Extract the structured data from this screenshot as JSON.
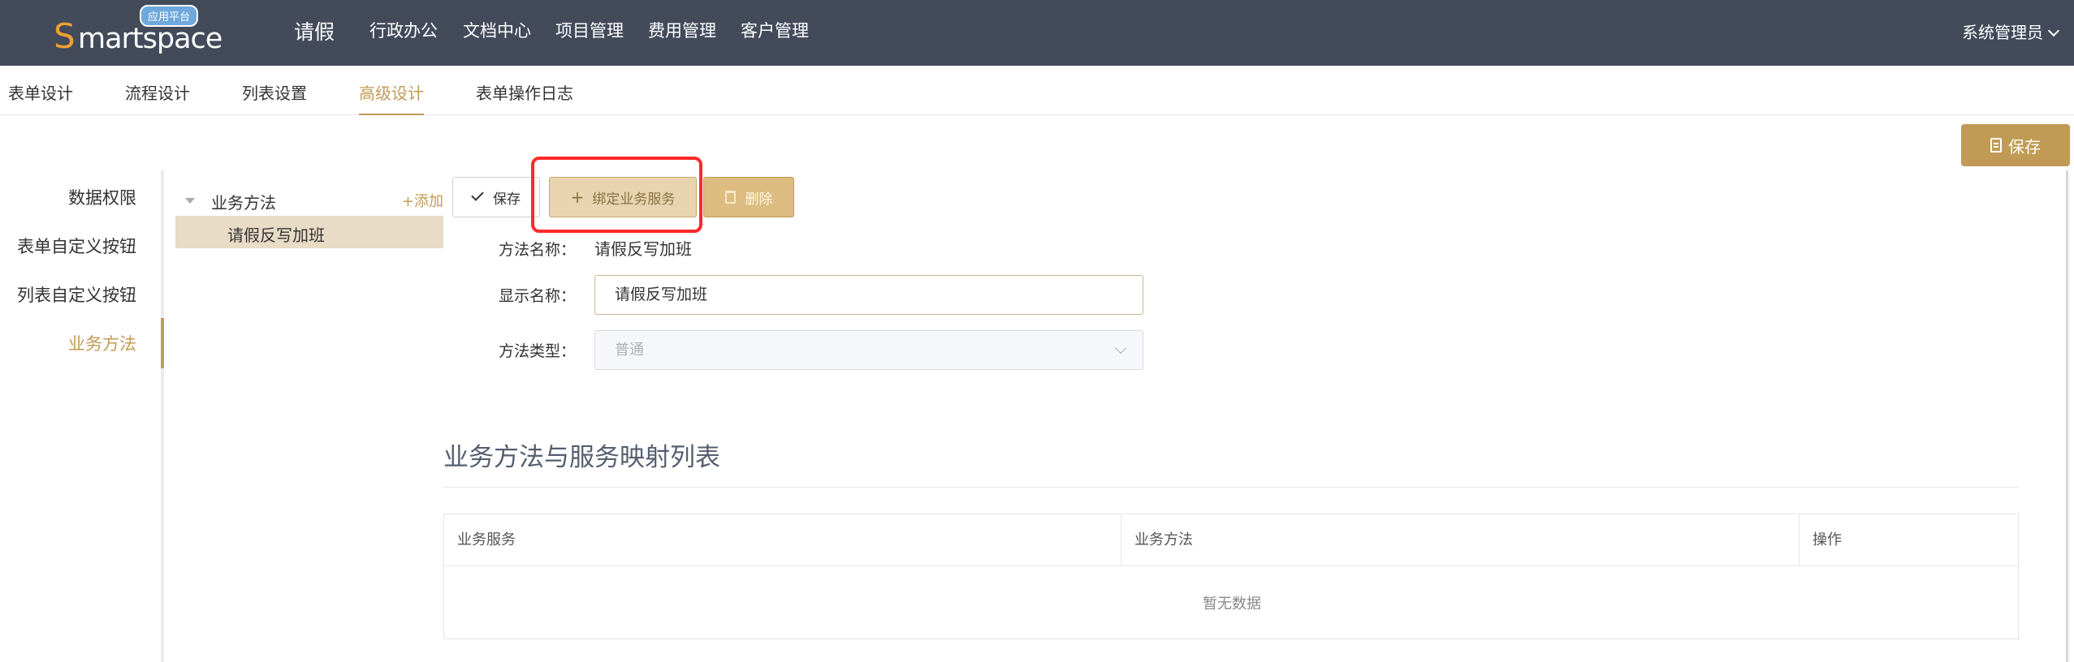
{
  "header": {
    "logo_initial": "S",
    "logo_rest": "martspace",
    "logo_badge": "应用平台",
    "app_title": "请假",
    "nav": [
      "行政办公",
      "文档中心",
      "项目管理",
      "费用管理",
      "客户管理"
    ],
    "user": "系统管理员"
  },
  "tabs": [
    "表单设计",
    "流程设计",
    "列表设置",
    "高级设计",
    "表单操作日志"
  ],
  "active_tab": "高级设计",
  "top_save_label": "保存",
  "left_menu": [
    "数据权限",
    "表单自定义按钮",
    "列表自定义按钮",
    "业务方法"
  ],
  "active_left_menu": "业务方法",
  "tree": {
    "root_label": "业务方法",
    "add_label": "+添加",
    "child_label": "请假反写加班"
  },
  "toolbar": {
    "save_label": "保存",
    "bind_label": "绑定业务服务",
    "delete_label": "删除"
  },
  "form": {
    "method_name_label": "方法名称：",
    "method_name_value": "请假反写加班",
    "display_name_label": "显示名称：",
    "display_name_value": "请假反写加班",
    "method_type_label": "方法类型：",
    "method_type_value": "普通"
  },
  "mapping": {
    "title": "业务方法与服务映射列表",
    "columns": [
      "业务服务",
      "业务方法",
      "操作"
    ],
    "empty_text": "暂无数据"
  },
  "colors": {
    "header_bg": "#434a5a",
    "accent": "#c19b55",
    "highlight": "#ff2a2a"
  }
}
